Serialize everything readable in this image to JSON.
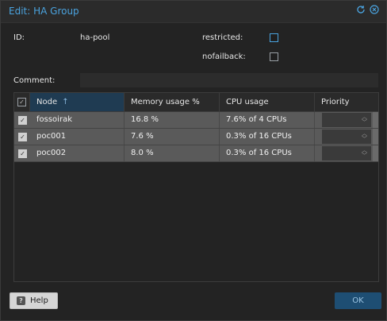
{
  "window": {
    "title": "Edit: HA Group"
  },
  "title_tools": {
    "refresh_icon": "refresh-icon",
    "close_icon": "close-icon"
  },
  "form": {
    "id_label": "ID:",
    "id_value": "ha-pool",
    "restricted_label": "restricted:",
    "nofailback_label": "nofailback:",
    "comment_label": "Comment:",
    "comment_value": ""
  },
  "grid": {
    "columns": [
      "Node",
      "Memory usage %",
      "CPU usage",
      "Priority"
    ],
    "sort_indicator": "↑",
    "rows": [
      {
        "node": "fossoirak",
        "memory": "16.8 %",
        "cpu": "7.6% of 4 CPUs",
        "priority": ""
      },
      {
        "node": "poc001",
        "memory": "7.6 %",
        "cpu": "0.3% of 16 CPUs",
        "priority": ""
      },
      {
        "node": "poc002",
        "memory": "8.0 %",
        "cpu": "0.3% of 16 CPUs",
        "priority": ""
      }
    ]
  },
  "footer": {
    "help_label": "Help",
    "ok_label": "OK"
  },
  "colors": {
    "accent": "#4aa3df",
    "row_selected": "#5a5a5a",
    "ok_button": "#1e4e73"
  }
}
